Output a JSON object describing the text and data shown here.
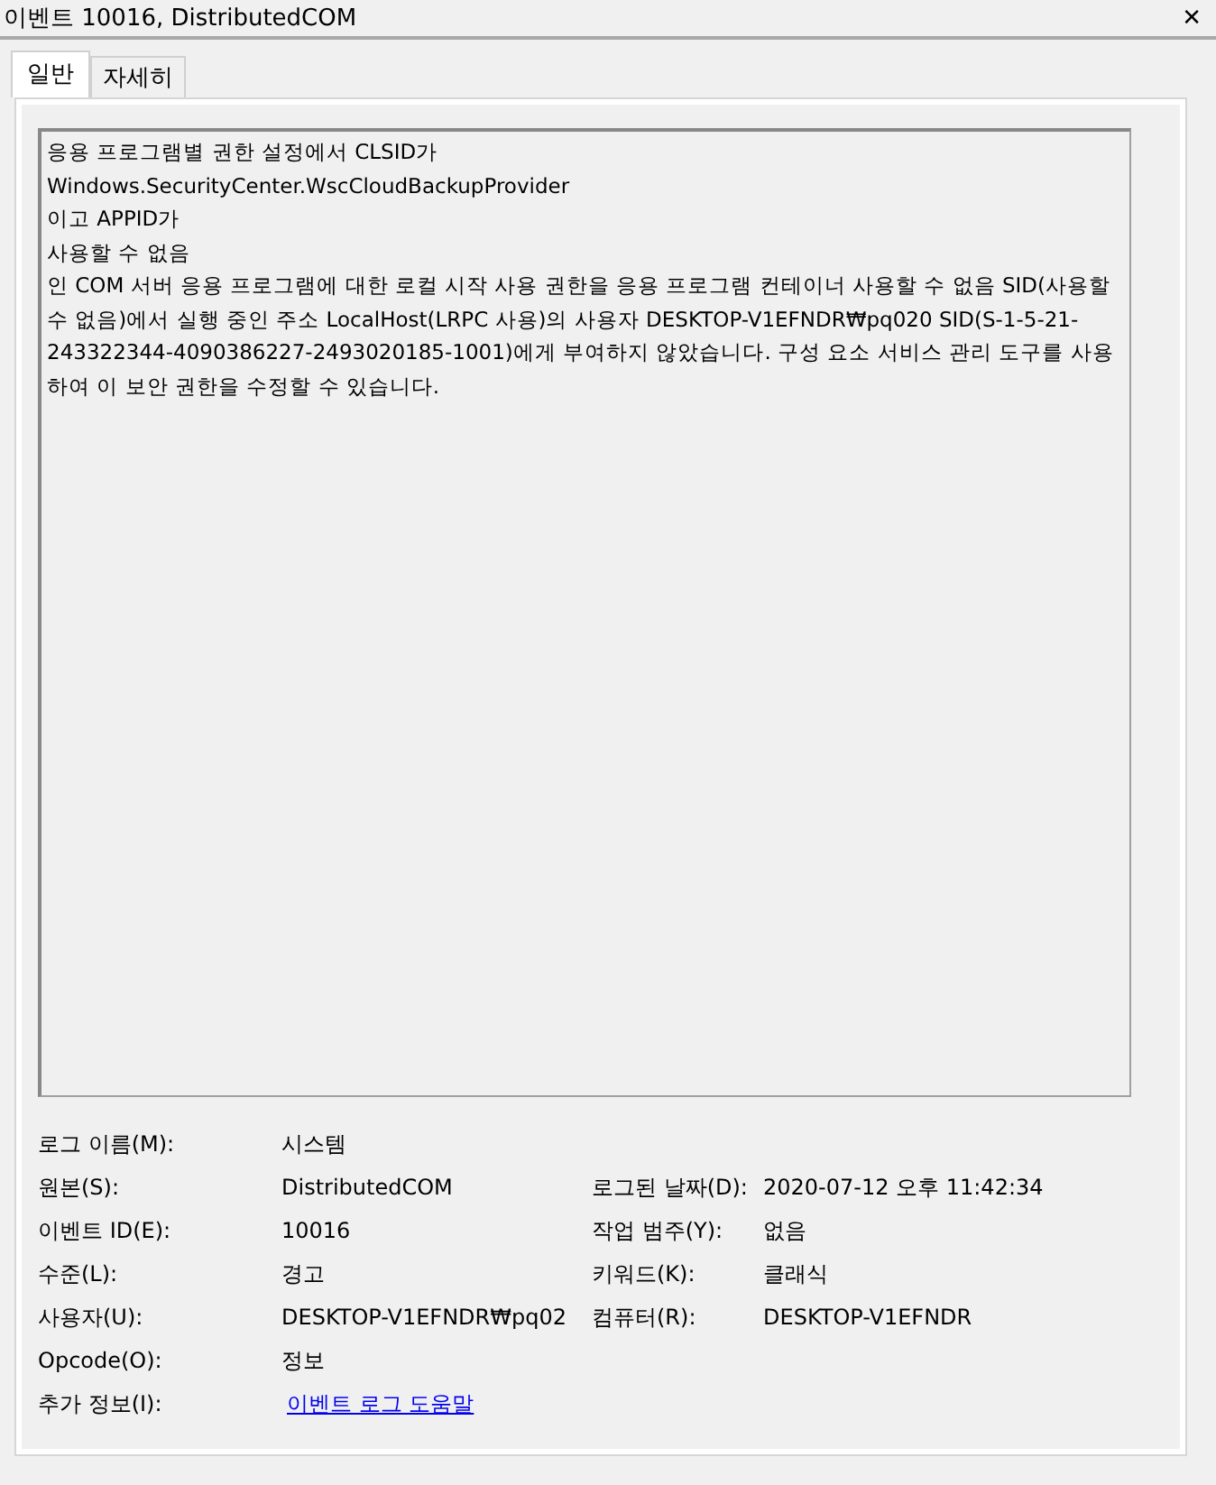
{
  "window": {
    "title": "이벤트 10016, DistributedCOM",
    "close": "✕"
  },
  "tabs": [
    {
      "label": "일반",
      "selected": true
    },
    {
      "label": "자세히",
      "selected": false
    }
  ],
  "message": {
    "lines": [
      "응용 프로그램별 권한 설정에서 CLSID가",
      "Windows.SecurityCenter.WscCloudBackupProvider",
      "이고 APPID가",
      "사용할 수 없음",
      "인 COM 서버 응용 프로그램에 대한 로컬 시작 사용 권한을 응용 프로그램 컨테이너 사용할 수 없음 SID(사용할 수 없음)에서 실행 중인 주소 LocalHost(LRPC 사용)의 사용자 DESKTOP-V1EFNDR₩pq020 SID(S-1-5-21-243322344-4090386227-2493020185-1001)에게 부여하지 않았습니다. 구성 요소 서비스 관리 도구를 사용하여 이 보안 권한을 수정할 수 있습니다."
    ]
  },
  "fields": [
    {
      "label": "로그 이름(M):",
      "value": "시스템",
      "kind": "text"
    },
    {
      "label": "원본(S):",
      "value": "DistributedCOM",
      "kind": "text",
      "label2": "로그된 날짜(D):",
      "value2": "2020-07-12 오후 11:42:34"
    },
    {
      "label": "이벤트 ID(E):",
      "value": "10016",
      "kind": "text",
      "label2": "작업 범주(Y):",
      "value2": "없음"
    },
    {
      "label": "수준(L):",
      "value": "경고",
      "kind": "text",
      "label2": "키워드(K):",
      "value2": "클래식"
    },
    {
      "label": "사용자(U):",
      "value": "DESKTOP-V1EFNDR₩pq02",
      "kind": "text",
      "label2": "컴퓨터(R):",
      "value2": "DESKTOP-V1EFNDR"
    },
    {
      "label": "Opcode(O):",
      "value": "정보",
      "kind": "text"
    },
    {
      "label": "추가 정보(I):",
      "value": "이벤트 로그 도움말",
      "kind": "link"
    }
  ]
}
